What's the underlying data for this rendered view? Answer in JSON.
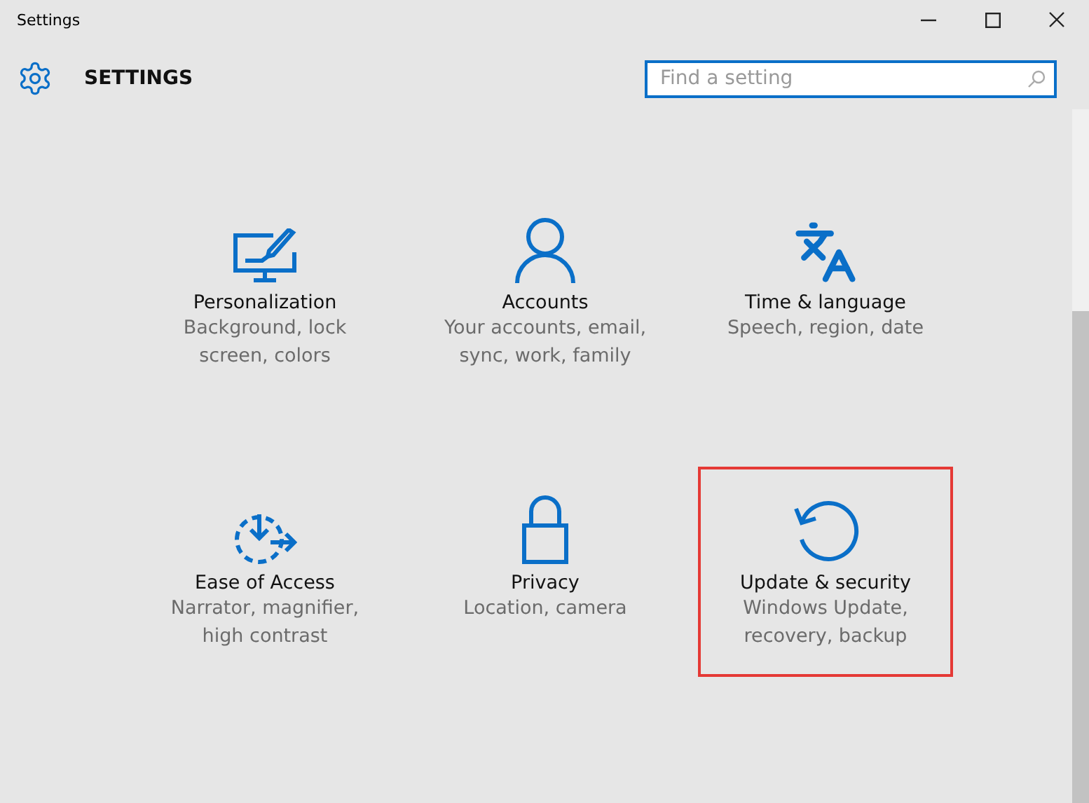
{
  "window": {
    "title": "Settings"
  },
  "header": {
    "title": "SETTINGS",
    "search": {
      "placeholder": "Find a setting"
    }
  },
  "categories": [
    {
      "kind": "personalization",
      "title": "Personalization",
      "description": "Background, lock screen, colors",
      "highlighted": false
    },
    {
      "kind": "accounts",
      "title": "Accounts",
      "description": "Your accounts, email, sync, work, family",
      "highlighted": false
    },
    {
      "kind": "time",
      "title": "Time & language",
      "description": "Speech, region, date",
      "highlighted": false
    },
    {
      "kind": "ease",
      "title": "Ease of Access",
      "description": "Narrator, magnifier, high contrast",
      "highlighted": false
    },
    {
      "kind": "privacy",
      "title": "Privacy",
      "description": "Location, camera",
      "highlighted": false
    },
    {
      "kind": "update",
      "title": "Update & security",
      "description": "Windows Update, recovery, backup",
      "highlighted": true
    }
  ]
}
